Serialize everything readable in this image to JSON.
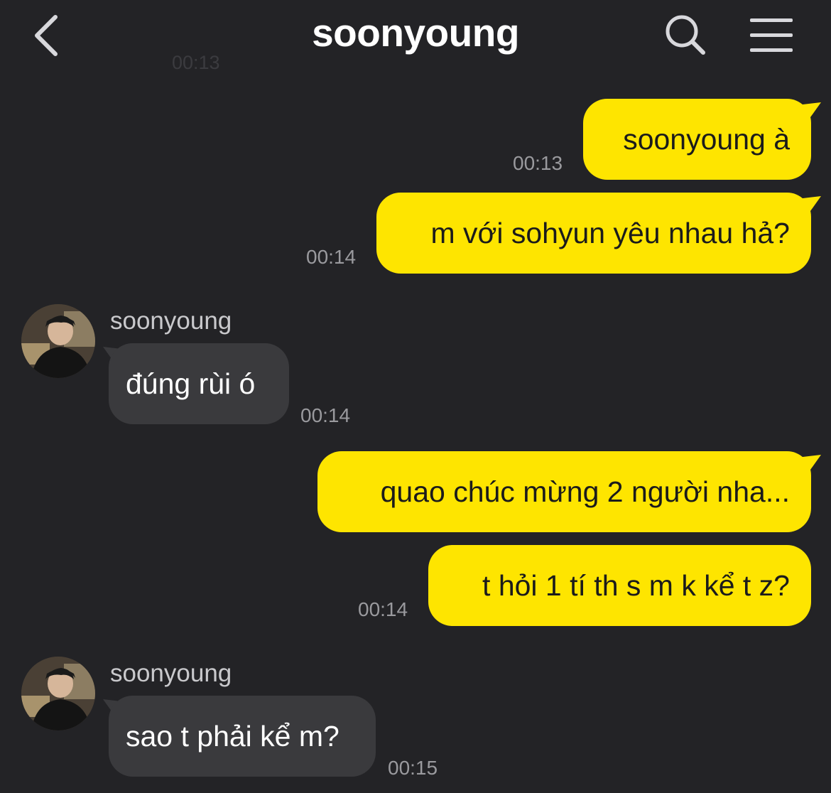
{
  "header": {
    "title": "soonyoung",
    "back_icon": "chevron-left-icon",
    "search_icon": "search-icon",
    "menu_icon": "hamburger-menu-icon"
  },
  "faded_timestamp": "00:13",
  "colors": {
    "background": "#232326",
    "outgoing_bubble": "#fee500",
    "incoming_bubble": "#3a3a3d",
    "timestamp": "#9a9a9e"
  },
  "messages": [
    {
      "direction": "outgoing",
      "text": "soonyoung à",
      "time": "00:13"
    },
    {
      "direction": "outgoing",
      "text": "m với sohyun yêu nhau hả?",
      "time": "00:14"
    },
    {
      "direction": "incoming",
      "sender": "soonyoung",
      "text": "đúng rùi ó",
      "time": "00:14"
    },
    {
      "direction": "outgoing",
      "text": "quao chúc mừng 2 người nha...",
      "time": ""
    },
    {
      "direction": "outgoing",
      "text": "t hỏi 1 tí th s m k kể t z?",
      "time": "00:14"
    },
    {
      "direction": "incoming",
      "sender": "soonyoung",
      "text": "sao t phải kể m?",
      "time": "00:15"
    }
  ]
}
